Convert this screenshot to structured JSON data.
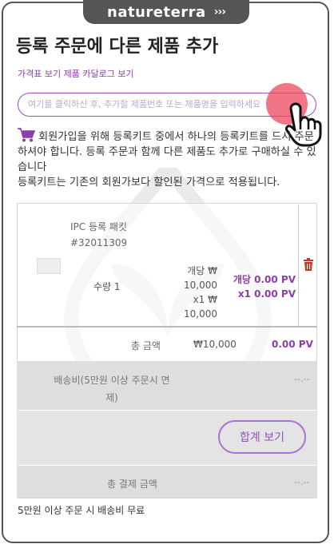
{
  "brand": {
    "name": "natureterra",
    "chevrons": "›››"
  },
  "page": {
    "title": "등록 주문에 다른 제품 추가"
  },
  "links": {
    "catalog": "가격표 보기 제품 카달로그 보기"
  },
  "search": {
    "placeholder": "여기를 클릭하신 후, 추가할 제품번호 또는 제품명을 입력하세요"
  },
  "notice": {
    "line1": "회원가입을 위해 등록키트 중에서 하나의 등록키트를 드시 주문하셔야 합니다. 등록 주문과 함께 다른 제품도 추가로 구매하실 수 있습니다",
    "line2": "등록키트는 기존의 회원가보다 할인된 가격으로 적용됩니다."
  },
  "item": {
    "name": "IPC 등록 패킷",
    "code": "#32011309",
    "qty_label": "수량 1",
    "unit_price": "개당 ₩ 10,000",
    "unit_price_l1": "개당 ₩",
    "unit_price_l2": "10,000",
    "line_price": "x1 ₩ 10,000",
    "pv_unit": "개당 0.00 PV",
    "pv_line": "x1 0.00 PV"
  },
  "totals": {
    "label": "총 금액",
    "amount": "₩10,000",
    "pv": "0.00 PV"
  },
  "shipping": {
    "label_l1": "배송비(5만원 이상 주문시 면",
    "label_l2": "제)",
    "value": "--.--"
  },
  "buttons": {
    "sum": "합계 보기"
  },
  "final": {
    "label": "총 결제 금액",
    "value": "--.--"
  },
  "footer": {
    "free_shipping": "5만원 이상 주문 시 배송비 무료"
  },
  "colors": {
    "accent": "#9b4fbf",
    "brand_bar": "#555555",
    "delete": "#c0392b",
    "tap": "#ec485c"
  }
}
